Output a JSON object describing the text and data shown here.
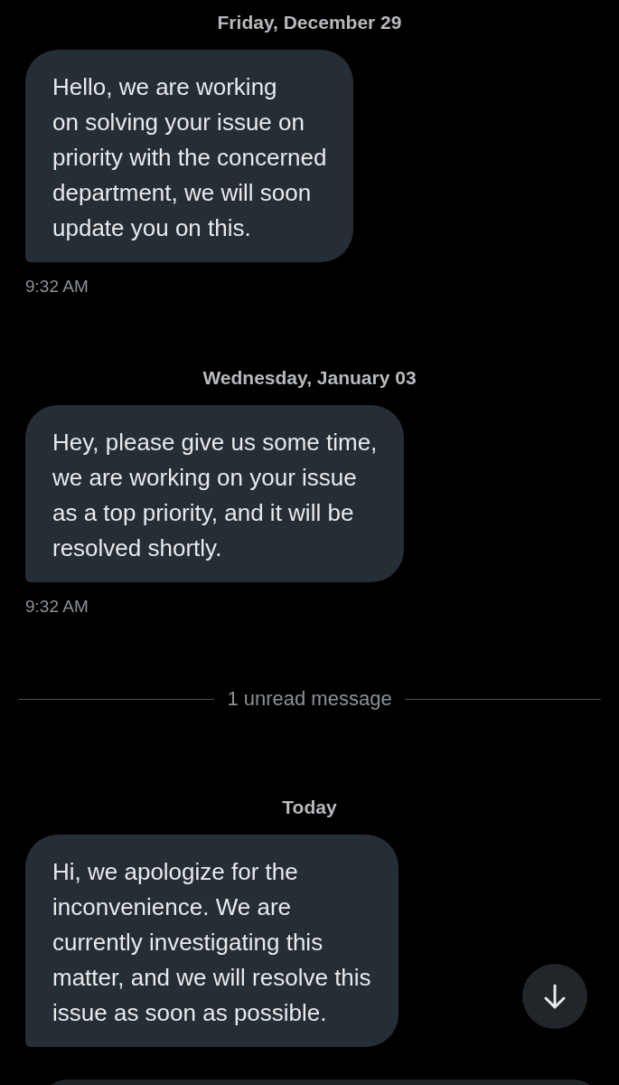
{
  "conversation": [
    {
      "kind": "date",
      "text": "Friday, December 29"
    },
    {
      "kind": "message",
      "text": "Hello, we are working\non solving your issue on\npriority with the concerned\ndepartment, we will soon\nupdate you on this.",
      "time": "9:32 AM"
    },
    {
      "kind": "date",
      "text": "Wednesday, January 03"
    },
    {
      "kind": "message",
      "text": "Hey, please give us some time,\nwe are working on your issue\nas a top priority, and it will be\nresolved shortly.",
      "time": "9:32 AM"
    },
    {
      "kind": "unread",
      "text": "1 unread message"
    },
    {
      "kind": "date",
      "text": "Today"
    },
    {
      "kind": "message",
      "text": "Hi, we apologize for the\ninconvenience. We are\ncurrently investigating this\nmatter, and we will resolve this\nissue as soon as possible."
    }
  ]
}
